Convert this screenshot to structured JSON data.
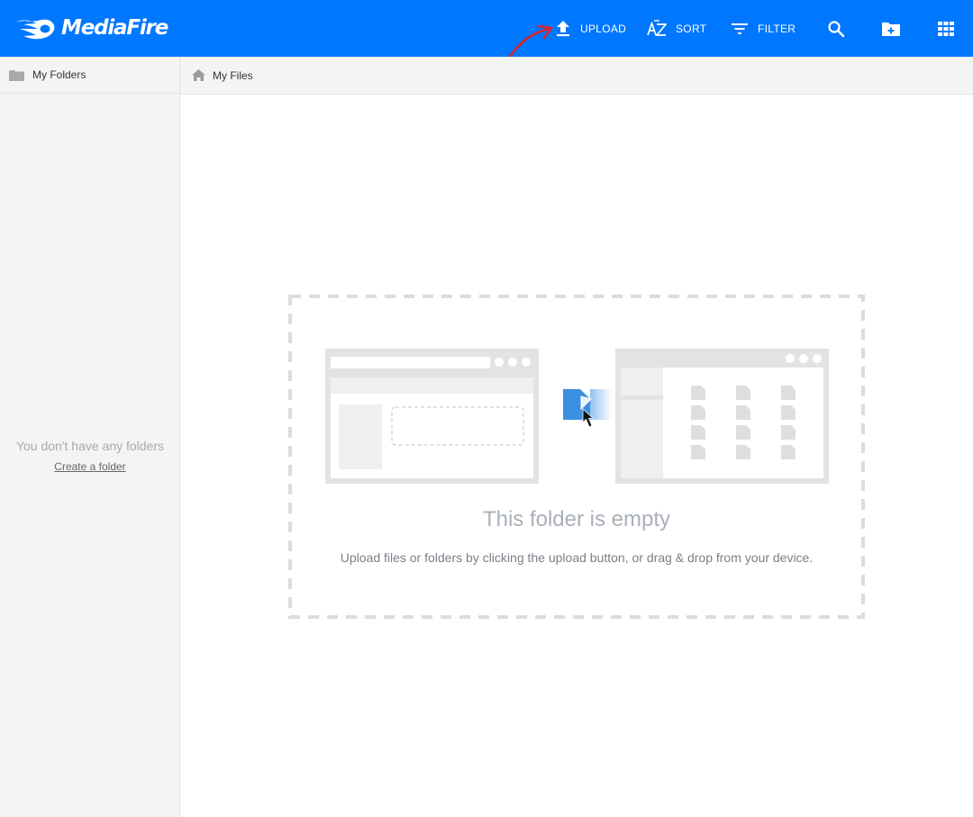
{
  "header": {
    "brand": "MediaFire",
    "upload_label": "UPLOAD",
    "sort_label": "SORT",
    "filter_label": "FILTER",
    "icons": {
      "upload": "upload-icon",
      "sort": "az-sort-icon",
      "filter": "filter-icon",
      "search": "search-icon",
      "new_folder": "new-folder-icon",
      "grid": "grid-view-icon"
    }
  },
  "sidebar": {
    "title": "My Folders",
    "empty_text": "You don't have any folders",
    "create_link": "Create a folder"
  },
  "breadcrumb": {
    "label": "My Files"
  },
  "empty_state": {
    "title": "This folder is empty",
    "subtitle": "Upload files or folders by clicking the upload button, or drag & drop from your device."
  },
  "colors": {
    "brand_blue": "#0077ff",
    "annotation_red": "#d9232e",
    "file_blue": "#3b8fe0",
    "panel_gray": "#e3e3e3"
  }
}
